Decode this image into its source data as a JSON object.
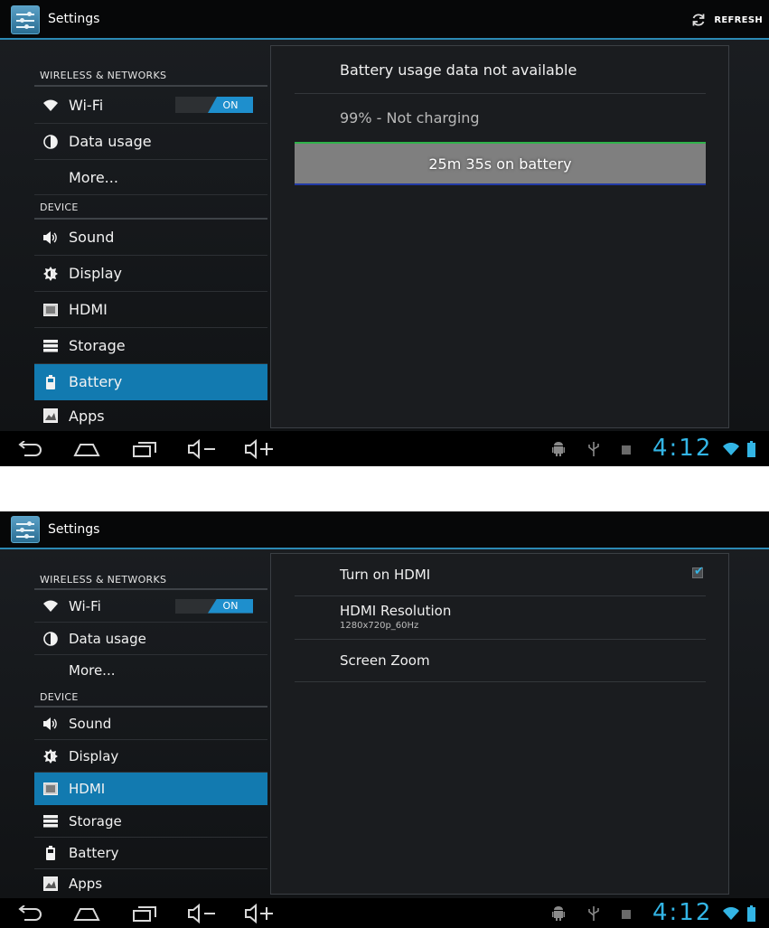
{
  "shot1": {
    "app_title": "Settings",
    "refresh_label": "REFRESH",
    "sidebar": {
      "wireless_category": "WIRELESS & NETWORKS",
      "device_category": "DEVICE",
      "wifi_label": "Wi-Fi",
      "wifi_toggle": "ON",
      "data_usage_label": "Data usage",
      "more_label": "More...",
      "sound_label": "Sound",
      "display_label": "Display",
      "hdmi_label": "HDMI",
      "storage_label": "Storage",
      "battery_label": "Battery",
      "apps_label": "Apps",
      "selected": "Battery"
    },
    "panel": {
      "usage_status": "Battery usage data not available",
      "charge_status": "99% - Not charging",
      "graph_label": "25m 35s on battery"
    },
    "status": {
      "clock": "4:12"
    }
  },
  "shot2": {
    "app_title": "Settings",
    "sidebar": {
      "wireless_category": "WIRELESS & NETWORKS",
      "device_category": "DEVICE",
      "wifi_label": "Wi-Fi",
      "wifi_toggle": "ON",
      "data_usage_label": "Data usage",
      "more_label": "More...",
      "sound_label": "Sound",
      "display_label": "Display",
      "hdmi_label": "HDMI",
      "storage_label": "Storage",
      "battery_label": "Battery",
      "apps_label": "Apps",
      "selected": "HDMI"
    },
    "panel": {
      "turn_on_hdmi": "Turn on HDMI",
      "turn_on_hdmi_checked": true,
      "hdmi_resolution": "HDMI Resolution",
      "hdmi_resolution_value": "1280x720p_60Hz",
      "screen_zoom": "Screen Zoom"
    },
    "status": {
      "clock": "4:12"
    }
  },
  "colors": {
    "accent": "#33b5e5",
    "selected": "#127ab0",
    "toggle_on": "#1e8fcd"
  }
}
